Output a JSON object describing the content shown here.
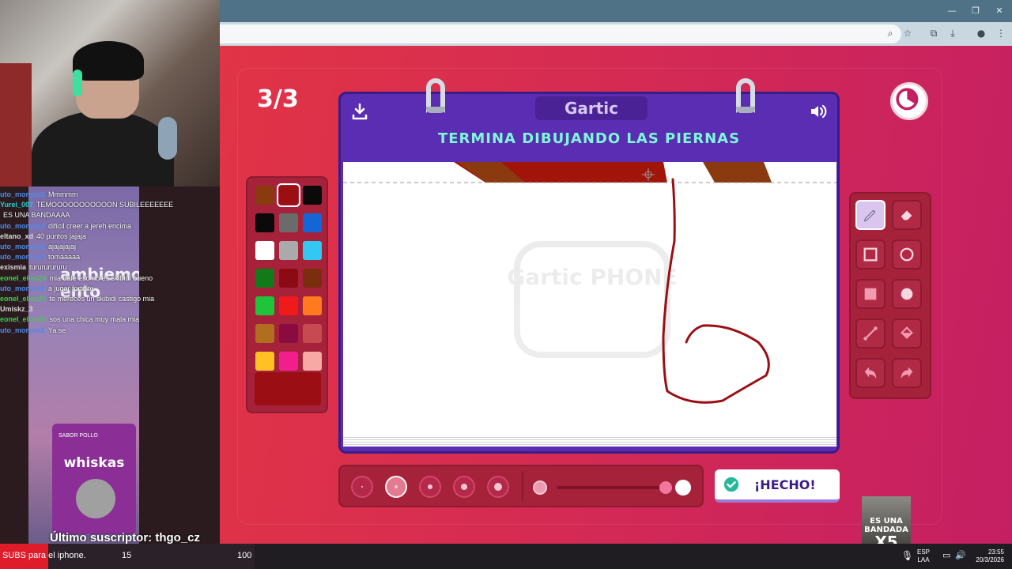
{
  "game": {
    "round": "3/3",
    "logo": "Gartic",
    "prompt": "TERMINA DIBUJANDO LAS PIERNAS",
    "done_label": "¡HECHO!",
    "watermark": "Gartic PHONE",
    "current_color": "#9b0f14",
    "stroke_color": "#9b0f14",
    "palette": [
      "#8b3a10",
      "#9b0f14",
      "#0a0a0a",
      "#0a0a0a",
      "#6b6b6b",
      "#1466d6",
      "#ffffff",
      "#aaaaaa",
      "#33c8f2",
      "#127a18",
      "#8b0a14",
      "#7a2e0e",
      "#20c43a",
      "#f01a1a",
      "#ff7a1e",
      "#b06e1e",
      "#8a0a42",
      "#c64a52",
      "#ffc023",
      "#f21e8c",
      "#f7a9a6"
    ],
    "selected_swatch": 1,
    "brush_sizes": [
      "xs",
      "s",
      "m",
      "l",
      "xl"
    ],
    "selected_size": 1,
    "opacity_level": 1.0
  },
  "tools": [
    "pencil-icon",
    "eraser-icon",
    "rect-outline-icon",
    "circle-outline-icon",
    "rect-fill-icon",
    "circle-fill-icon",
    "line-icon",
    "bucket-icon",
    "undo-icon",
    "redo-icon"
  ],
  "chat": [
    {
      "user": "uto_morgan2",
      "color": "#4a8cf0",
      "text": "Mmmmm"
    },
    {
      "user": "Yurei_007",
      "color": "#1fd1d1",
      "text": "TEMOOOOOOOOOOON SUBILEEEEEEE"
    },
    {
      "user": "",
      "color": "#ff3b3b",
      "text": "ES UNA BANDAAAA"
    },
    {
      "user": "uto_morgan2",
      "color": "#4a8cf0",
      "text": "difícil creer a jereh encima"
    },
    {
      "user": "eltano_xd",
      "color": "#d8d8d8",
      "text": "40 puntos jajaja"
    },
    {
      "user": "uto_morgan2",
      "color": "#4a8cf0",
      "text": "ajajajajaj"
    },
    {
      "user": "uto_morgan2",
      "color": "#4a8cf0",
      "text": "tomaaaaa"
    },
    {
      "user": "exismia",
      "color": "#d8d8d8",
      "text": "turururururu"
    },
    {
      "user": "eonel_elias20",
      "color": "#34d34a",
      "text": "mia dale eso no es skibidi bueno"
    },
    {
      "user": "uto_morgan2",
      "color": "#4a8cf0",
      "text": "a jugar fortnite"
    },
    {
      "user": "eonel_elias20",
      "color": "#34d34a",
      "text": "te mereces un skibidi castigo mia"
    },
    {
      "user": "Umiskz_3",
      "color": "#d8d8d8",
      "text": ""
    },
    {
      "user": "eonel_elias20",
      "color": "#34d34a",
      "text": "sos una chica muy mala mia"
    },
    {
      "user": "uto_morgan2",
      "color": "#4a8cf0",
      "text": "Ya se"
    }
  ],
  "overlay": {
    "chat_bg_text": "ambiemos\nento",
    "whiskas_brand": "whiskas",
    "whiskas_flavor": "SABOR POLLO",
    "last_sub": "Último suscriptor: thgo_cz",
    "promo_line1": "ES UNA BANDADA",
    "promo_line2": "X5"
  },
  "taskbar": {
    "ticker_text": "SUBS para el iphone.",
    "count_current": "15",
    "count_goal": "100",
    "lang1": "ESP",
    "lang2": "LAA",
    "time": "23:55",
    "date": "20/3/2026"
  }
}
